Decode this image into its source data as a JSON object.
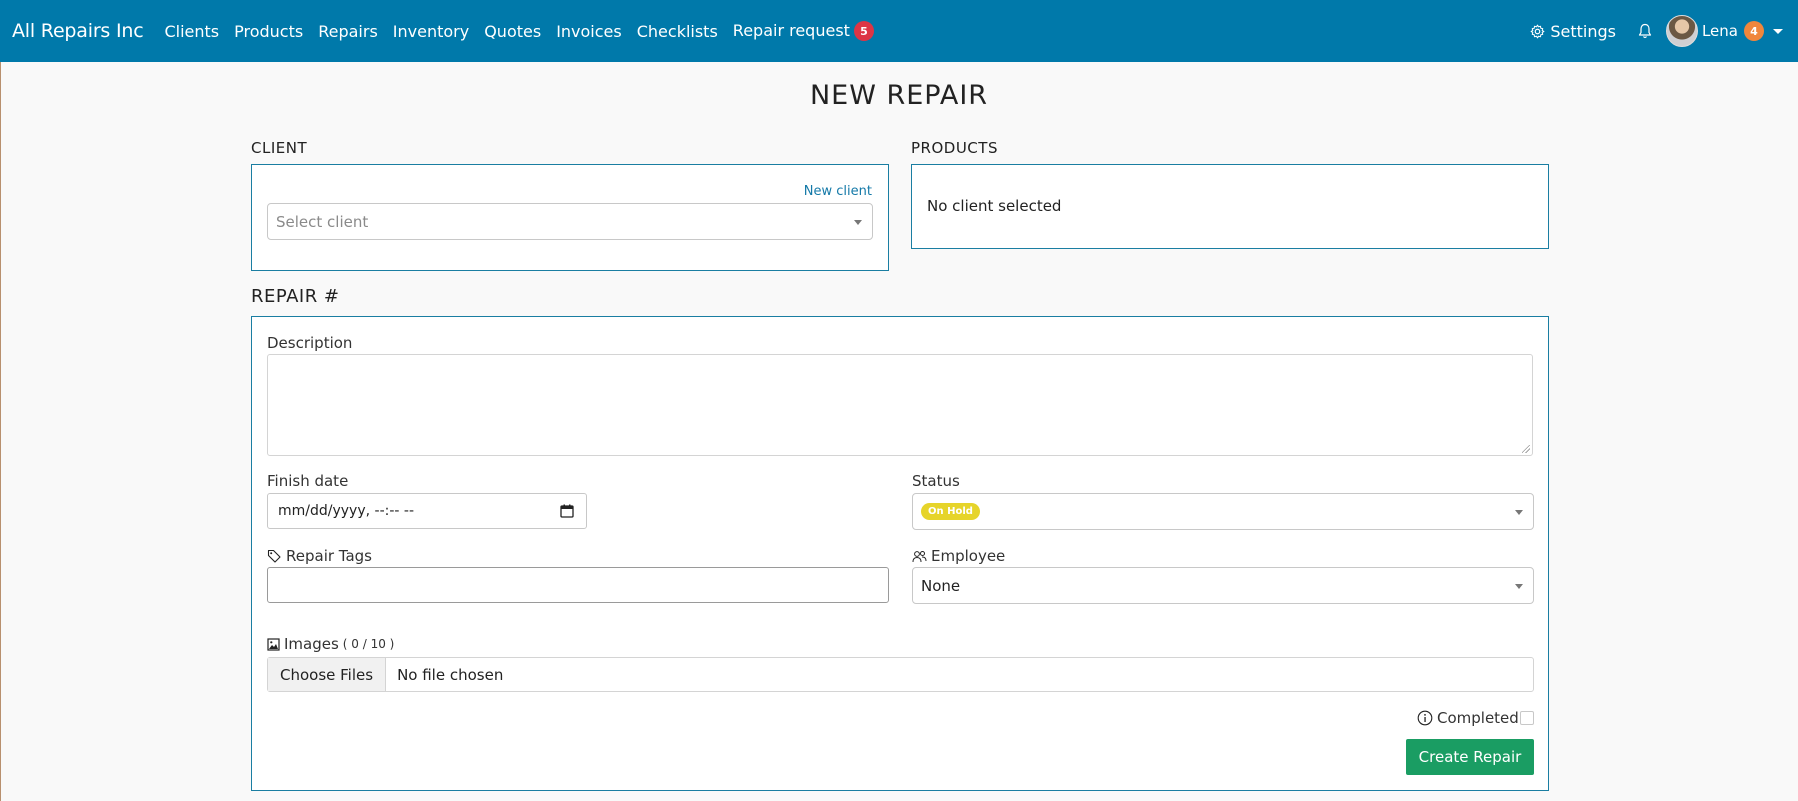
{
  "navbar": {
    "brand": "All Repairs Inc",
    "items": [
      {
        "label": "Clients"
      },
      {
        "label": "Products"
      },
      {
        "label": "Repairs"
      },
      {
        "label": "Inventory"
      },
      {
        "label": "Quotes"
      },
      {
        "label": "Invoices"
      },
      {
        "label": "Checklists"
      },
      {
        "label": "Repair request",
        "badge": "5"
      }
    ],
    "settings_label": "Settings",
    "user_name": "Lena",
    "user_badge": "4"
  },
  "page": {
    "title": "NEW REPAIR"
  },
  "client_section": {
    "title": "CLIENT",
    "new_client_link": "New client",
    "select_placeholder": "Select client"
  },
  "products_section": {
    "title": "PRODUCTS",
    "empty_text": "No client selected"
  },
  "repair_section": {
    "title": "REPAIR #",
    "description_label": "Description",
    "finish_date_label": "Finish date",
    "finish_date_placeholder": "mm/dd/yyyy, --:-- --",
    "status_label": "Status",
    "status_value": "On Hold",
    "tags_label": "Repair Tags",
    "employee_label": "Employee",
    "employee_value": "None",
    "images_label": "Images",
    "images_count": "( 0 / 10 )",
    "choose_files_label": "Choose Files",
    "file_status": "No file chosen",
    "completed_label": "Completed",
    "create_button": "Create Repair"
  },
  "colors": {
    "navbar": "#0079aa",
    "accent_border": "#1a7ea2",
    "create_button": "#1a9d63",
    "status_on_hold": "#e6d42a",
    "repair_badge": "#dc3545",
    "user_badge": "#f0863c"
  }
}
